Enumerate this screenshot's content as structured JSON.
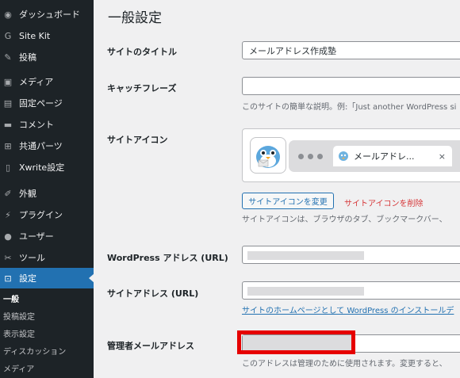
{
  "sidebar": {
    "items": [
      {
        "label": "ダッシュボード",
        "icon": "dashboard-icon",
        "glyph": "◉"
      },
      {
        "label": "Site Kit",
        "icon": "sitekit-g-icon",
        "glyph": "G"
      },
      {
        "label": "投稿",
        "icon": "pushpin-icon",
        "glyph": "✎"
      },
      {
        "label": "メディア",
        "icon": "media-icon",
        "glyph": "▣"
      },
      {
        "label": "固定ページ",
        "icon": "page-icon",
        "glyph": "▤"
      },
      {
        "label": "コメント",
        "icon": "comment-icon",
        "glyph": "▬"
      },
      {
        "label": "共通パーツ",
        "icon": "grid-icon",
        "glyph": "⊞"
      },
      {
        "label": "Xwrite設定",
        "icon": "book-icon",
        "glyph": "▯"
      },
      {
        "label": "外観",
        "icon": "paintbrush-icon",
        "glyph": "✐"
      },
      {
        "label": "プラグイン",
        "icon": "plug-icon",
        "glyph": "⚡"
      },
      {
        "label": "ユーザー",
        "icon": "user-icon",
        "glyph": "●"
      },
      {
        "label": "ツール",
        "icon": "wrench-icon",
        "glyph": "✂"
      },
      {
        "label": "設定",
        "icon": "settings-icon",
        "glyph": "⊡"
      }
    ],
    "submenu": [
      {
        "label": "一般"
      },
      {
        "label": "投稿設定"
      },
      {
        "label": "表示設定"
      },
      {
        "label": "ディスカッション"
      },
      {
        "label": "メディア"
      }
    ]
  },
  "page": {
    "title": "一般設定"
  },
  "form": {
    "site_title": {
      "label": "サイトのタイトル",
      "value": "メールアドレス作成塾"
    },
    "tagline": {
      "label": "キャッチフレーズ",
      "value": "",
      "description": "このサイトの簡単な説明。例:「Just another WordPress si"
    },
    "site_icon": {
      "label": "サイトアイコン",
      "tab_text": "メールアドレ...",
      "close_glyph": "×",
      "change_button": "サイトアイコンを変更",
      "delete_link": "サイトアイコンを削除",
      "description": "サイトアイコンは、ブラウザのタブ、ブックマークバー、"
    },
    "wp_address": {
      "label": "WordPress アドレス (URL)"
    },
    "site_address": {
      "label": "サイトアドレス (URL)",
      "description": "サイトのホームページとして WordPress のインストールデ"
    },
    "admin_email": {
      "label": "管理者メールアドレス",
      "description": "このアドレスは管理のために使用されます。変更すると、"
    }
  },
  "colors": {
    "sidebar_bg": "#1d2327",
    "active_blue": "#2271b1",
    "highlight_red": "#e60000",
    "delete_red": "#d63638"
  }
}
